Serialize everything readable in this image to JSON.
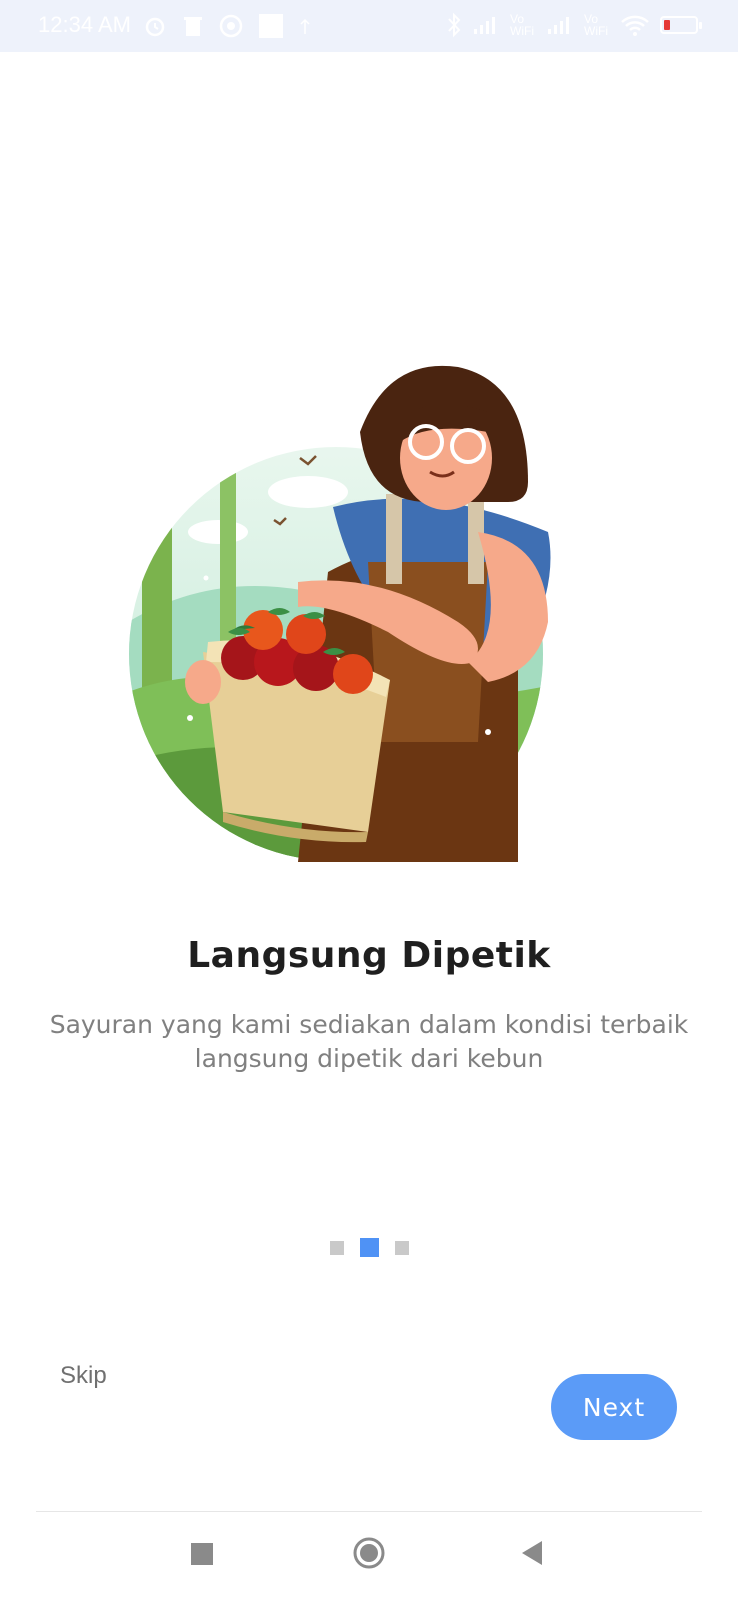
{
  "status_bar": {
    "time": "12:34 AM",
    "left_icons": [
      "alarm-icon",
      "trash-icon",
      "viber-icon",
      "app-icon",
      "upload-icon"
    ],
    "right_icons": [
      "bluetooth-icon",
      "signal-icon",
      "signal-icon",
      "wifi-icon",
      "battery-icon"
    ],
    "vowifi_label_1": "Vo WiFi",
    "vowifi_label_2": "Vo WiFi",
    "battery_color": "#e53935"
  },
  "onboarding": {
    "title": "Langsung Dipetik",
    "description": "Sayuran yang kami sediakan dalam kondisi terbaik langsung dipetik dari kebun",
    "page_count": 3,
    "active_page": 2
  },
  "actions": {
    "skip_label": "Skip",
    "next_label": "Next"
  },
  "navigation": {
    "buttons": [
      "recents-icon",
      "home-icon",
      "back-icon"
    ]
  },
  "colors": {
    "accent": "#5b9bf7",
    "indicator_inactive": "#c9c9c9",
    "title": "#1f1f1f",
    "description": "#808080"
  }
}
